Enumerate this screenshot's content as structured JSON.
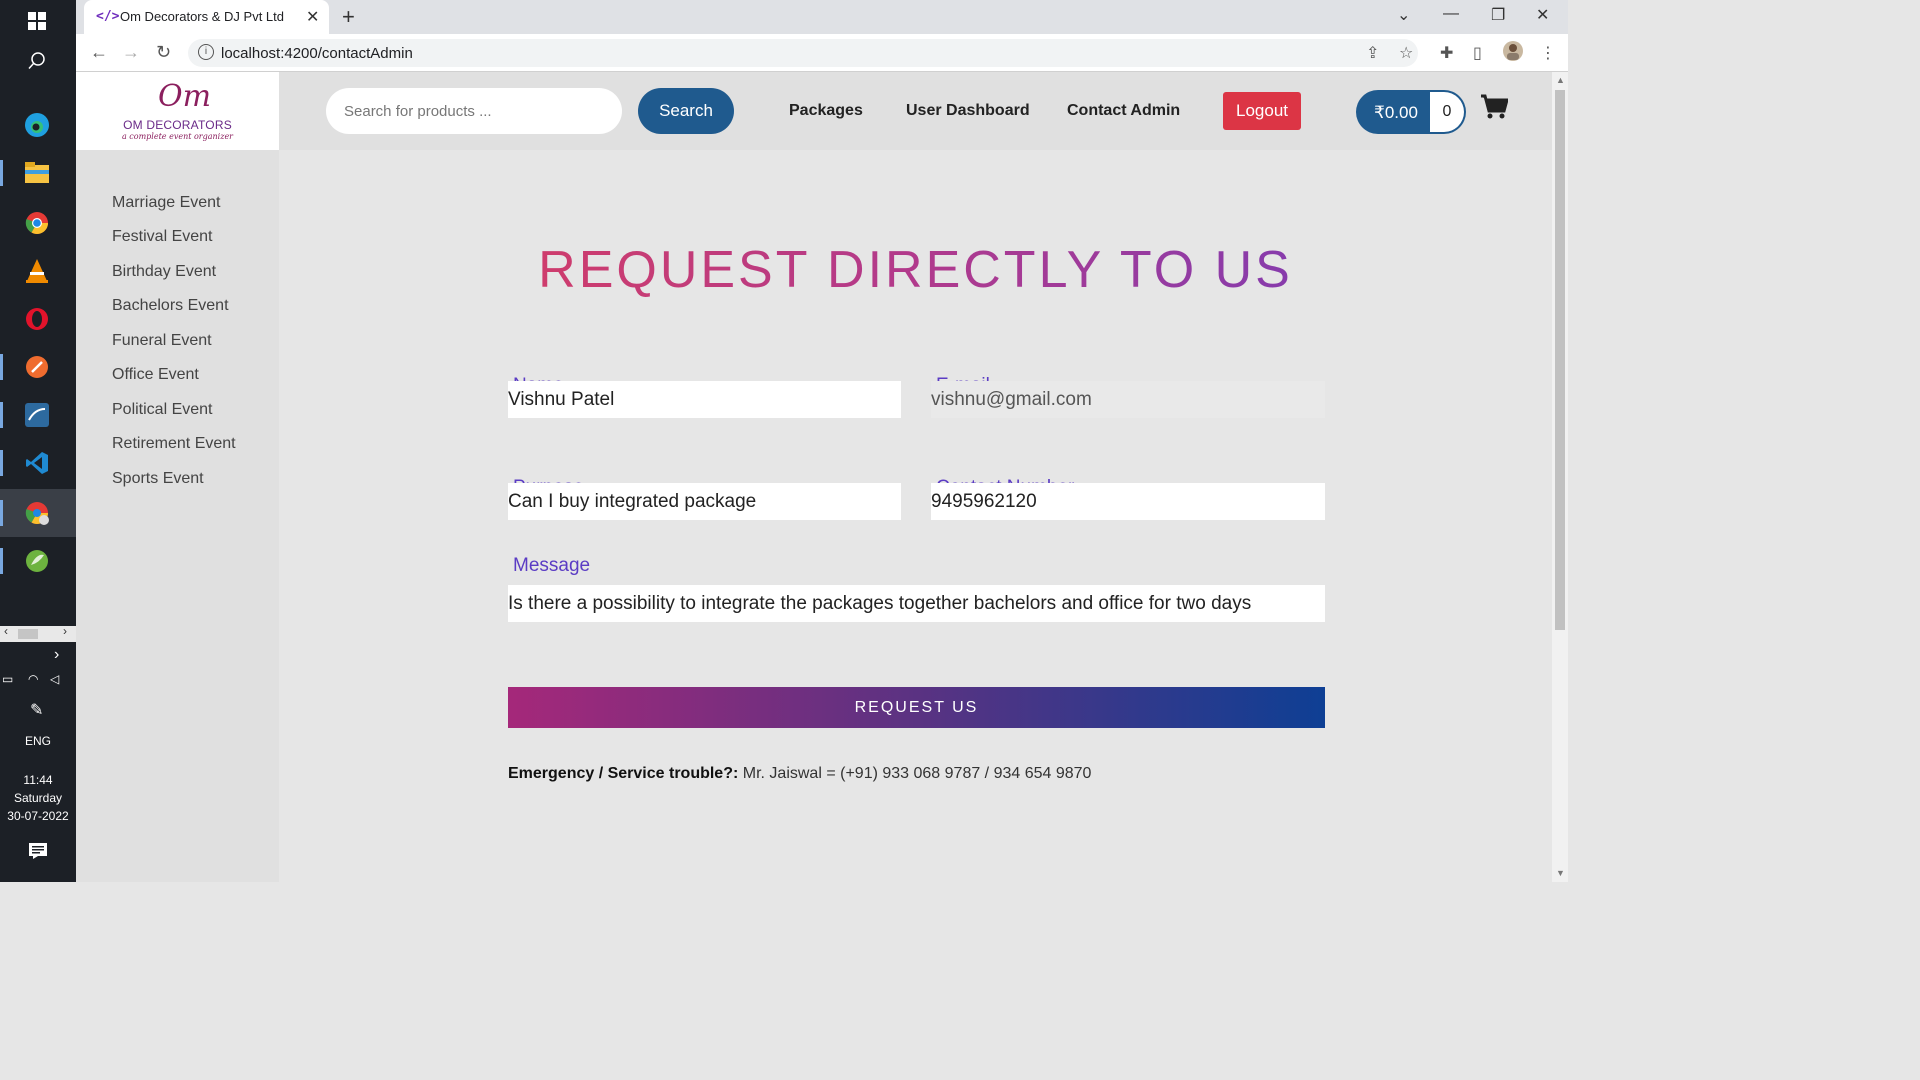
{
  "taskbar": {
    "language": "ENG",
    "time": "11:44",
    "day": "Saturday",
    "date": "30-07-2022"
  },
  "browser": {
    "tab_title": "Om Decorators & DJ Pvt Ltd",
    "url": "localhost:4200/contactAdmin"
  },
  "header": {
    "logo_mark": "Om",
    "logo_name": "OM DECORATORS",
    "logo_tagline": "a complete event organizer",
    "search_placeholder": "Search for products ...",
    "search_label": "Search",
    "nav": [
      "Packages",
      "User Dashboard",
      "Contact Admin"
    ],
    "logout_label": "Logout",
    "cart_amount": "₹0.00",
    "cart_count": "0"
  },
  "sidebar": {
    "items": [
      "Marriage Event",
      "Festival Event",
      "Birthday Event",
      "Bachelors Event",
      "Funeral Event",
      "Office Event",
      "Political Event",
      "Retirement Event",
      "Sports Event"
    ]
  },
  "main": {
    "heading": "REQUEST DIRECTLY TO US",
    "name_label": "Name",
    "name_value": "Vishnu Patel",
    "email_label": "E-mail",
    "email_value": "vishnu@gmail.com",
    "purpose_label": "Purpose",
    "purpose_value": "Can I buy integrated package",
    "contact_label": "Contact Number",
    "contact_value": "9495962120",
    "message_label": "Message",
    "message_value": "Is there a possibility to integrate the packages together bachelors and office for two days",
    "submit_label": "REQUEST US",
    "emergency_label": "Emergency / Service trouble?:",
    "emergency_text": " Mr. Jaiswal = (+91) 933 068 9787 / 934 654 9870"
  },
  "colors": {
    "primary_blue": "#1f5a8e",
    "logout_red": "#dc3545",
    "label_purple": "#5b3cc4"
  }
}
